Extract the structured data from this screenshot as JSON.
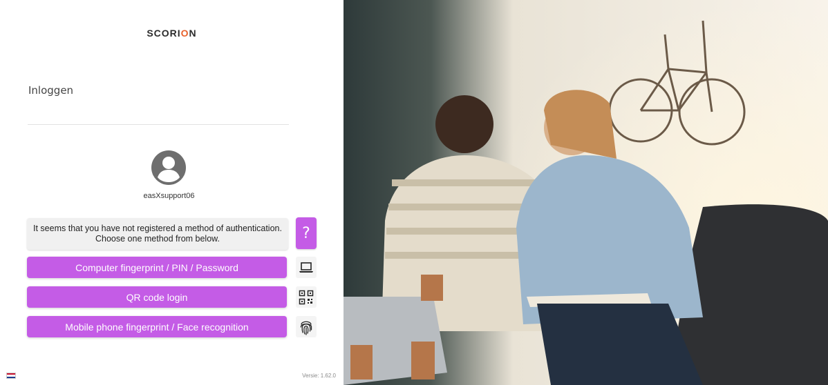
{
  "brand": {
    "logo_prefix": "SCORI",
    "logo_o": "O",
    "logo_suffix": "N"
  },
  "page": {
    "title": "Inloggen"
  },
  "user": {
    "username": "easXsupport06"
  },
  "notice": {
    "line1": "It seems that you have not registered a method of authentication.",
    "line2": "Choose one method from below."
  },
  "help_button": {
    "label": "?"
  },
  "methods": [
    {
      "label": "Computer fingerprint / PIN / Password",
      "icon": "laptop-icon"
    },
    {
      "label": "QR code login",
      "icon": "qr-code-icon"
    },
    {
      "label": "Mobile phone fingerprint / Face recognition",
      "icon": "fingerprint-icon"
    }
  ],
  "footer": {
    "version": "Versie: 1.62.0",
    "language_flag": "nl-flag-icon"
  },
  "colors": {
    "accent": "#c45ce6",
    "logo_accent": "#e8612c",
    "text": "#222222"
  }
}
